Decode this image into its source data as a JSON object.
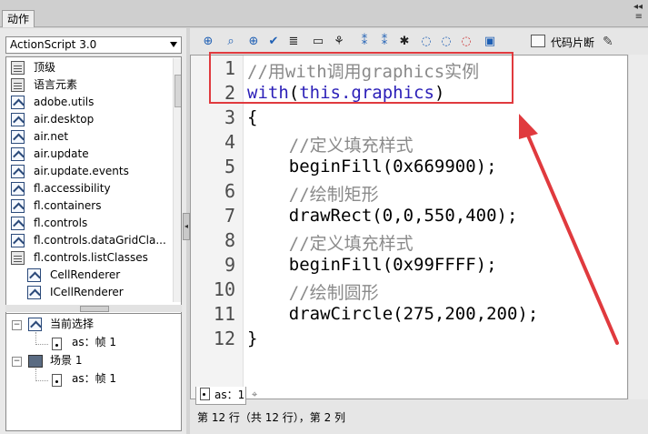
{
  "panel_title": "动作",
  "window_controls": {
    "menu_label": "≡"
  },
  "left": {
    "language_select": "ActionScript 3.0",
    "tree_items": [
      {
        "label": "顶级",
        "icon": "book-icon"
      },
      {
        "label": "语言元素",
        "icon": "book-icon"
      },
      {
        "label": "adobe.utils",
        "icon": "package-icon"
      },
      {
        "label": "air.desktop",
        "icon": "package-icon"
      },
      {
        "label": "air.net",
        "icon": "package-icon"
      },
      {
        "label": "air.update",
        "icon": "package-icon"
      },
      {
        "label": "air.update.events",
        "icon": "package-icon"
      },
      {
        "label": "fl.accessibility",
        "icon": "package-icon"
      },
      {
        "label": "fl.containers",
        "icon": "package-icon"
      },
      {
        "label": "fl.controls",
        "icon": "package-icon"
      },
      {
        "label": "fl.controls.dataGridCla...",
        "icon": "package-icon"
      },
      {
        "label": "fl.controls.listClasses",
        "icon": "book-open-icon"
      },
      {
        "label": "CellRenderer",
        "icon": "class-icon"
      },
      {
        "label": "ICellRenderer",
        "icon": "class-icon"
      }
    ],
    "bottom_tree": {
      "current_selection": "当前选择",
      "current_frame": "as：帧 1",
      "scene": "场景 1",
      "scene_frame": "as：帧 1"
    }
  },
  "right": {
    "snippets_label": "代码片断",
    "toolbar_icons": [
      "add-icon",
      "find-icon",
      "target-icon",
      "check-syntax-icon",
      "auto-format-icon",
      "code-hint-icon",
      "debug-icon",
      "collapse-between-braces-icon",
      "collapse-selection-icon",
      "expand-all-icon",
      "apply-block-comment-icon",
      "apply-line-comment-icon",
      "remove-comment-icon",
      "show-hide-toolbox-icon"
    ],
    "code_lines": [
      {
        "n": "1",
        "text": "//用with调用graphics实例",
        "kind": "comment"
      },
      {
        "n": "2",
        "text": "with(this.graphics)",
        "kind": "keyword"
      },
      {
        "n": "3",
        "text": "{",
        "kind": "plain"
      },
      {
        "n": "4",
        "text": "    //定义填充样式",
        "kind": "comment"
      },
      {
        "n": "5",
        "text": "    beginFill(0x669900);",
        "kind": "plain"
      },
      {
        "n": "6",
        "text": "    //绘制矩形",
        "kind": "comment"
      },
      {
        "n": "7",
        "text": "    drawRect(0,0,550,400);",
        "kind": "plain"
      },
      {
        "n": "8",
        "text": "    //定义填充样式",
        "kind": "comment"
      },
      {
        "n": "9",
        "text": "    beginFill(0x99FFFF);",
        "kind": "plain"
      },
      {
        "n": "10",
        "text": "    //绘制圆形",
        "kind": "comment"
      },
      {
        "n": "11",
        "text": "    drawCircle(275,200,200);",
        "kind": "plain"
      },
      {
        "n": "12",
        "text": "}",
        "kind": "plain"
      }
    ],
    "script_tab": "as：1",
    "status": "第 12 行（共 12 行），第 2 列"
  },
  "colors": {
    "annotation_red": "#e03a3e",
    "comment_gray": "#8a8a8a",
    "keyword_blue": "#2b1fb8"
  }
}
